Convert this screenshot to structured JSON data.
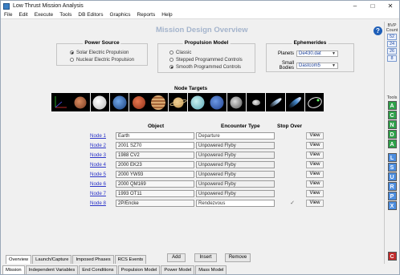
{
  "window": {
    "title": "Low Thrust Mission Analysis"
  },
  "menu": [
    "File",
    "Edit",
    "Execute",
    "Tools",
    "DB Editors",
    "Graphics",
    "Reports",
    "Help"
  ],
  "heading": "Mission Design Overview",
  "power_source": {
    "label": "Power Source",
    "options": [
      {
        "label": "Solar Electric Propulsion",
        "selected": true
      },
      {
        "label": "Nuclear Electric Propulsion",
        "selected": false
      }
    ]
  },
  "propulsion_model": {
    "label": "Propulsion Model",
    "options": [
      {
        "label": "Classic",
        "selected": false
      },
      {
        "label": "Stepped Programmed Controls",
        "selected": false
      },
      {
        "label": "Smooth Programmed Controls",
        "selected": true
      }
    ]
  },
  "ephemerides": {
    "label": "Ephemerides",
    "planets_label": "Planets",
    "planets_value": "De430.dat",
    "small_bodies_label": "Small Bodies",
    "small_bodies_value": "Dastcom5"
  },
  "node_targets_label": "Node Targets",
  "columns": {
    "object": "Object",
    "encounter": "Encounter Type",
    "stopover": "Stop Over"
  },
  "nodes": [
    {
      "link": "Node 1",
      "object": "Earth",
      "encounter": "Departure",
      "stop": "",
      "view": "View"
    },
    {
      "link": "Node 2",
      "object": "2001 SZ70",
      "encounter": "Unpowered Flyby",
      "stop": "",
      "view": "View"
    },
    {
      "link": "Node 3",
      "object": "1988 CV2",
      "encounter": "Unpowered Flyby",
      "stop": "",
      "view": "View"
    },
    {
      "link": "Node 4",
      "object": "2000 EK23",
      "encounter": "Unpowered Flyby",
      "stop": "",
      "view": "View"
    },
    {
      "link": "Node 5",
      "object": "2000 YW93",
      "encounter": "Unpowered Flyby",
      "stop": "",
      "view": "View"
    },
    {
      "link": "Node 6",
      "object": "2000 QM169",
      "encounter": "Unpowered Flyby",
      "stop": "",
      "view": "View"
    },
    {
      "link": "Node 7",
      "object": "1993 OT11",
      "encounter": "Unpowered Flyby",
      "stop": "",
      "view": "View"
    },
    {
      "link": "Node 8",
      "object": "2P/Encke",
      "encounter": "Rendezvous",
      "stop": "✓",
      "view": "View"
    }
  ],
  "buttons": {
    "add": "Add",
    "insert": "Insert",
    "remove": "Remove"
  },
  "tabs_top": [
    "Overview",
    "Launch/Capture",
    "Imposed Phases",
    "RCS Events"
  ],
  "tabs_bottom": [
    "Mission",
    "Independent Variables",
    "End Conditions",
    "Propulsion Model",
    "Power Model",
    "Mass Model"
  ],
  "right_panel": {
    "bvp_label": "BVP",
    "count_label": "Count",
    "bvp_counts": [
      "52",
      "24",
      "26",
      "8"
    ],
    "tools_label": "Tools",
    "green_tools": [
      "A",
      "C",
      "N",
      "D",
      "A"
    ],
    "blue_tools": [
      "L",
      "S",
      "U",
      "R",
      "P",
      "X"
    ],
    "red_tool": "C"
  }
}
